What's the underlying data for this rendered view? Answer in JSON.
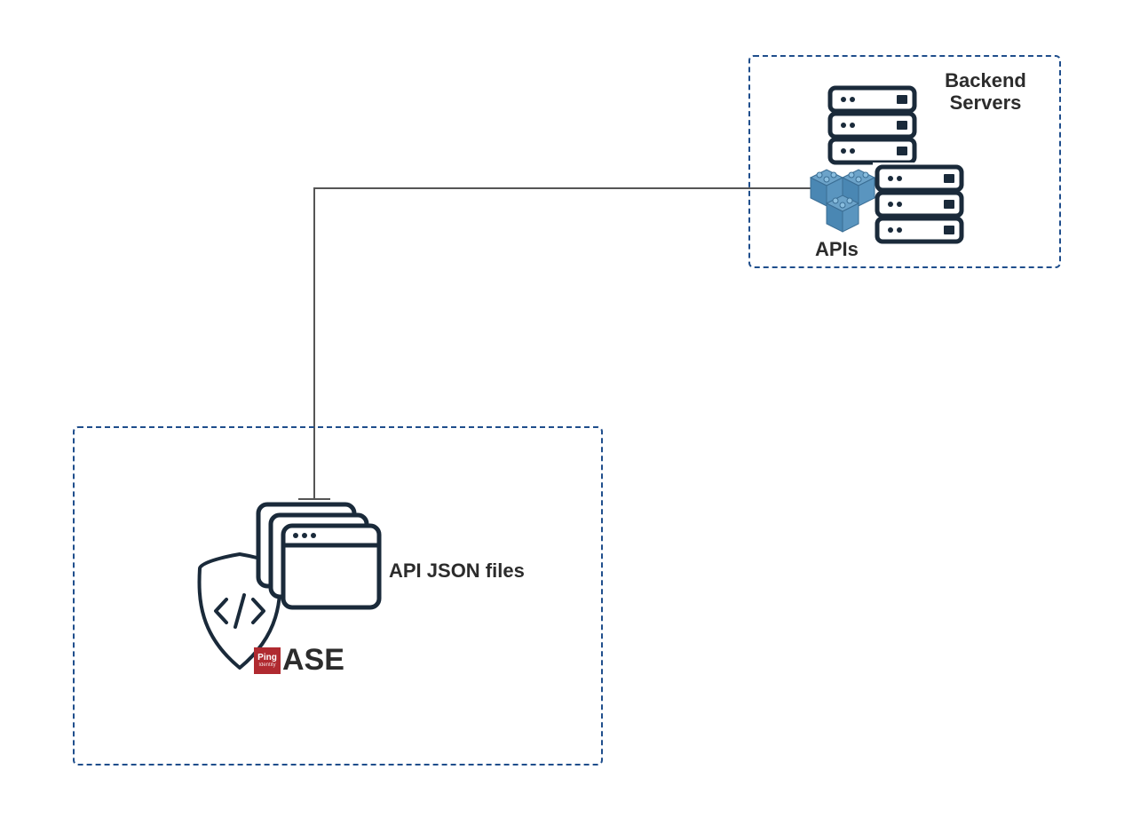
{
  "ase_box": {
    "ping_badge_top": "Ping",
    "ping_badge_bottom": "Identity",
    "ase_label": "ASE",
    "api_json_label": "API JSON files"
  },
  "backend_box": {
    "title_line1": "Backend",
    "title_line2": "Servers",
    "apis_label": "APIs"
  },
  "colors": {
    "dark": "#1a2a3a",
    "border_dashed": "#1f4e8c",
    "blue_cube_light": "#6ca3c9",
    "blue_cube_dark": "#4a87b3",
    "ping_red": "#b02a30"
  }
}
